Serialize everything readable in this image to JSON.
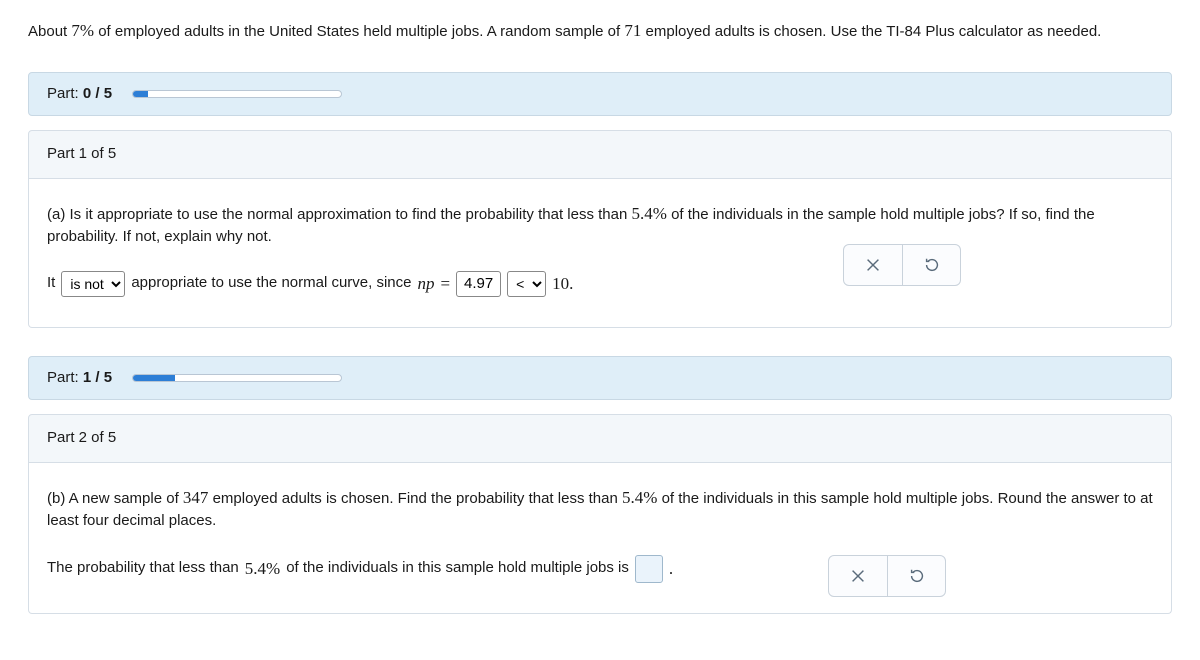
{
  "intro": {
    "prefix": "About ",
    "percent": "7%",
    "mid1": " of employed adults in the United States held multiple jobs. A random sample of ",
    "n": "71",
    "suffix": " employed adults is chosen. Use the TI-84 Plus calculator as needed."
  },
  "progress0": {
    "label_a": "Part: ",
    "label_b": "0 / 5",
    "percent": 7
  },
  "progress1": {
    "label_a": "Part: ",
    "label_b": "1 / 5",
    "percent": 20
  },
  "part1": {
    "heading": "Part 1 of 5",
    "q_prefix": "(a) Is it appropriate to use the normal approximation to find the probability that less than ",
    "q_pct": "5.4%",
    "q_suffix": " of the individuals in the sample hold multiple jobs? If so, find the probability. If not, explain why not.",
    "ans": {
      "it": "It",
      "drop1_value": "is not",
      "mid1": "appropriate to use the normal curve, since ",
      "var": "np",
      "eq": " = ",
      "np_value": "4.97",
      "drop2_value": "<",
      "ten": "10."
    }
  },
  "part2": {
    "heading": "Part 2 of 5",
    "q_prefix": "(b) A new sample of ",
    "q_n": "347",
    "q_mid": " employed adults is chosen. Find the probability that less than ",
    "q_pct": "5.4%",
    "q_suffix": " of the individuals in this sample hold multiple jobs. Round the answer to at least four decimal places.",
    "ans_prefix": "The probability that less than ",
    "ans_pct": "5.4%",
    "ans_suffix": " of the individuals in this sample hold multiple jobs is ",
    "period": "."
  },
  "buttons": {
    "clear": "clear",
    "reset": "reset"
  }
}
